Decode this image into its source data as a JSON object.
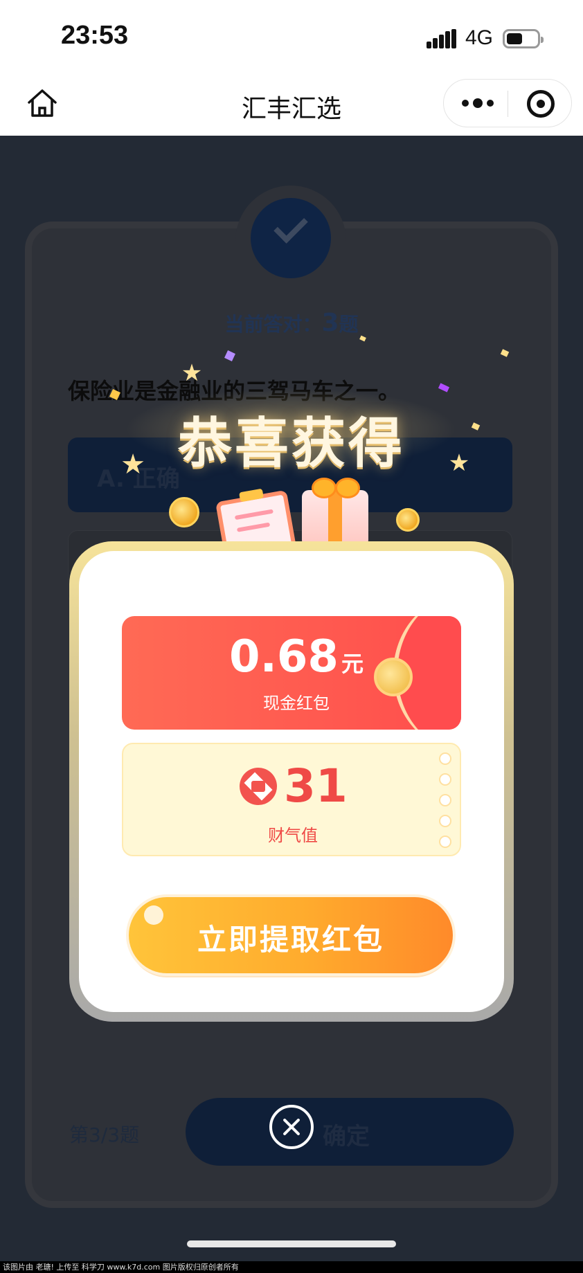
{
  "status_bar": {
    "time": "23:53",
    "network": "4G"
  },
  "nav": {
    "title": "汇丰汇选"
  },
  "quiz": {
    "score_prefix": "当前答对：",
    "score_value": "3",
    "score_suffix": "题",
    "question": "保险业是金融业的三驾马车之一。",
    "option_a": "A. 正确",
    "progress": "第3/3题",
    "confirm_label": "确定"
  },
  "reward": {
    "title": "恭喜获得",
    "cash_amount": "0.68",
    "cash_unit": "元",
    "cash_label": "现金红包",
    "luck_value": "31",
    "luck_label": "财气值",
    "claim_label": "立即提取红包"
  },
  "footer": {
    "watermark": "该图片由 老瑭! 上传至 科学刀 www.k7d.com 图片版权归原创者所有"
  },
  "colors": {
    "accent_red": "#ff4e4c",
    "accent_orange": "#ffab2d",
    "navy": "#0f1f38"
  },
  "icons": [
    "home-icon",
    "more-icon",
    "target-icon",
    "check-icon",
    "close-icon",
    "hsbc-logo-icon",
    "coin-icon",
    "gift-icon",
    "clipboard-icon",
    "star-icon"
  ]
}
